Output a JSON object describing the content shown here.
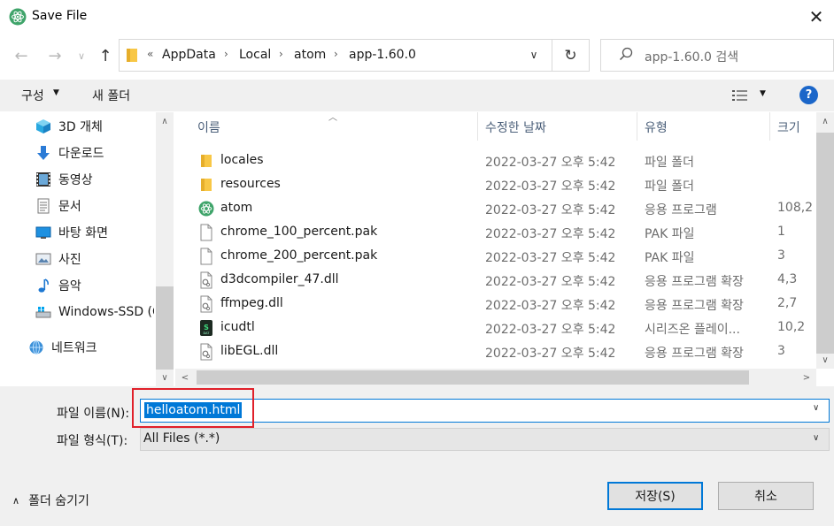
{
  "window": {
    "title": "Save File"
  },
  "address": {
    "overflow": "«",
    "crumbs": [
      "AppData",
      "Local",
      "atom",
      "app-1.60.0"
    ],
    "separator": "›"
  },
  "search": {
    "placeholder": "app-1.60.0 검색"
  },
  "commands": {
    "organize": "구성",
    "new_folder": "새 폴더",
    "help": "?"
  },
  "nav_items": [
    {
      "label": "3D 개체",
      "icon": "cube-3d-icon"
    },
    {
      "label": "다운로드",
      "icon": "download-arrow-icon"
    },
    {
      "label": "동영상",
      "icon": "film-icon"
    },
    {
      "label": "문서",
      "icon": "document-icon"
    },
    {
      "label": "바탕 화면",
      "icon": "desktop-icon"
    },
    {
      "label": "사진",
      "icon": "picture-icon"
    },
    {
      "label": "음악",
      "icon": "music-note-icon"
    },
    {
      "label": "Windows-SSD (C",
      "icon": "drive-icon"
    },
    {
      "label": "네트워크",
      "icon": "network-icon"
    }
  ],
  "columns": {
    "name": "이름",
    "date": "수정한 날짜",
    "type": "유형",
    "size": "크기"
  },
  "files": [
    {
      "name": "locales",
      "date": "2022-03-27 오후 5:42",
      "type": "파일 폴더",
      "size": "",
      "icon": "folder-icon"
    },
    {
      "name": "resources",
      "date": "2022-03-27 오후 5:42",
      "type": "파일 폴더",
      "size": "",
      "icon": "folder-icon"
    },
    {
      "name": "atom",
      "date": "2022-03-27 오후 5:42",
      "type": "응용 프로그램",
      "size": "108,2",
      "icon": "atom-app-icon"
    },
    {
      "name": "chrome_100_percent.pak",
      "date": "2022-03-27 오후 5:42",
      "type": "PAK 파일",
      "size": "1",
      "icon": "blank-file-icon"
    },
    {
      "name": "chrome_200_percent.pak",
      "date": "2022-03-27 오후 5:42",
      "type": "PAK 파일",
      "size": "3",
      "icon": "blank-file-icon"
    },
    {
      "name": "d3dcompiler_47.dll",
      "date": "2022-03-27 오후 5:42",
      "type": "응용 프로그램 확장",
      "size": "4,3",
      "icon": "dll-file-icon"
    },
    {
      "name": "ffmpeg.dll",
      "date": "2022-03-27 오후 5:42",
      "type": "응용 프로그램 확장",
      "size": "2,7",
      "icon": "dll-file-icon"
    },
    {
      "name": "icudtl",
      "date": "2022-03-27 오후 5:42",
      "type": "시리즈온 플레이...",
      "size": "10,2",
      "icon": "dat-file-icon"
    },
    {
      "name": "libEGL.dll",
      "date": "2022-03-27 오후 5:42",
      "type": "응용 프로그램 확장",
      "size": "3",
      "icon": "dll-file-icon"
    }
  ],
  "form": {
    "filename_label": "파일 이름(N):",
    "filename_value": "helloatom.html",
    "filetype_label": "파일 형식(T):",
    "filetype_value": "All Files (*.*)"
  },
  "footer": {
    "hide_folders": "폴더 숨기기",
    "save": "저장(S)",
    "cancel": "취소"
  },
  "colors": {
    "accent": "#0078d7",
    "highlight": "#e0202a",
    "folder": "#f8c746",
    "atom_green": "#3fa46a"
  }
}
